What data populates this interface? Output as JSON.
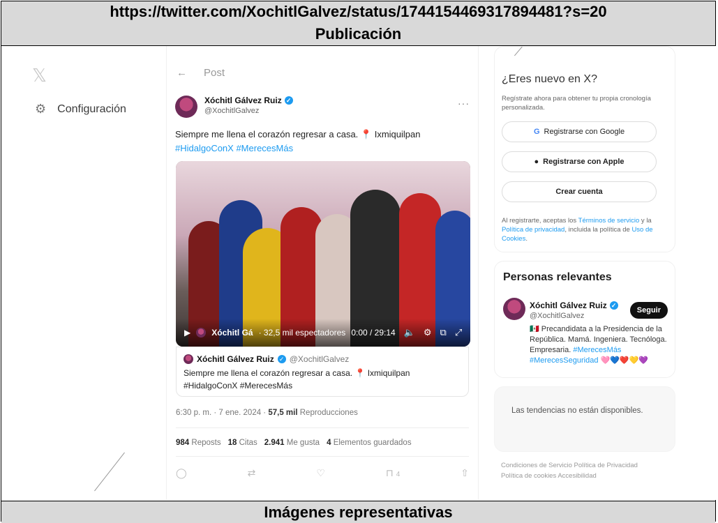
{
  "doc": {
    "url": "https://twitter.com/XochitlGalvez/status/1744154469317894481?s=20",
    "section_title": "Publicación",
    "footer_title": "Imágenes representativas"
  },
  "nav": {
    "logo": "𝕏",
    "config_label": "Configuración"
  },
  "post": {
    "back_label": "←",
    "header": "Post",
    "author_name": "Xóchitl Gálvez Ruiz",
    "author_handle": "@XochitlGalvez",
    "more": "···",
    "text_main": "Siempre me llena el corazón regresar a casa. ",
    "pin": "📍",
    "place": " Ixmiquilpan",
    "hashtags": "#HidalgoConX #MerecesMás",
    "video": {
      "channel": "Xóchitl Gá",
      "viewers": "· 32,5 mil espectadores",
      "time": "0:00 / 29:14"
    },
    "quote": {
      "name": "Xóchitl Gálvez Ruiz",
      "handle": "@XochitlGalvez",
      "text": "Siempre me llena el corazón regresar a casa. 📍 Ixmiquilpan #HidalgoConX #MerecesMás"
    },
    "meta": {
      "datetime": "6:30 p. m. · 7 ene. 2024 · ",
      "views_value": "57,5 mil",
      "views_label": " Reproducciones"
    },
    "stats": {
      "reposts_value": "984",
      "reposts_label": "Reposts",
      "quotes_value": "18",
      "quotes_label": "Citas",
      "likes_value": "2.941",
      "likes_label": "Me gusta",
      "saves_value": "4",
      "saves_label": "Elementos guardados"
    },
    "actions": {
      "bookmark_count": "4"
    }
  },
  "signup": {
    "title": "¿Eres nuevo en X?",
    "subtitle": "Regístrate ahora para obtener tu propia cronología personalizada.",
    "google_label": "Registrarse con Google",
    "apple_label": "Registrarse con Apple",
    "create_label": "Crear cuenta",
    "legal_pre": "Al registrarte, aceptas los ",
    "terms": "Términos de servicio",
    "legal_mid1": " y la ",
    "privacy": "Política de privacidad",
    "legal_mid2": ", incluida la política de ",
    "cookies": "Uso de Cookies",
    "legal_end": "."
  },
  "relevant": {
    "title": "Personas relevantes",
    "name": "Xóchitl Gálvez Ruiz",
    "handle": "@XochitlGalvez",
    "follow_label": "Seguir",
    "bio_main": "🇲🇽 Precandidata a la Presidencia de la República. Mamá. Ingeniera. Tecnóloga. Empresaria. ",
    "bio_tags": "#MerecesMás #MerecesSeguridad",
    "bio_hearts": " 🩷💙❤️💛💜"
  },
  "trends": {
    "message": "Las tendencias no están disponibles."
  },
  "footer": {
    "line1": "Condiciones de Servicio  Política de Privacidad",
    "line2": "Política de cookies  Accesibilidad"
  },
  "colors": {
    "accent": "#1d9bf0",
    "band": "#d9d9d9"
  }
}
